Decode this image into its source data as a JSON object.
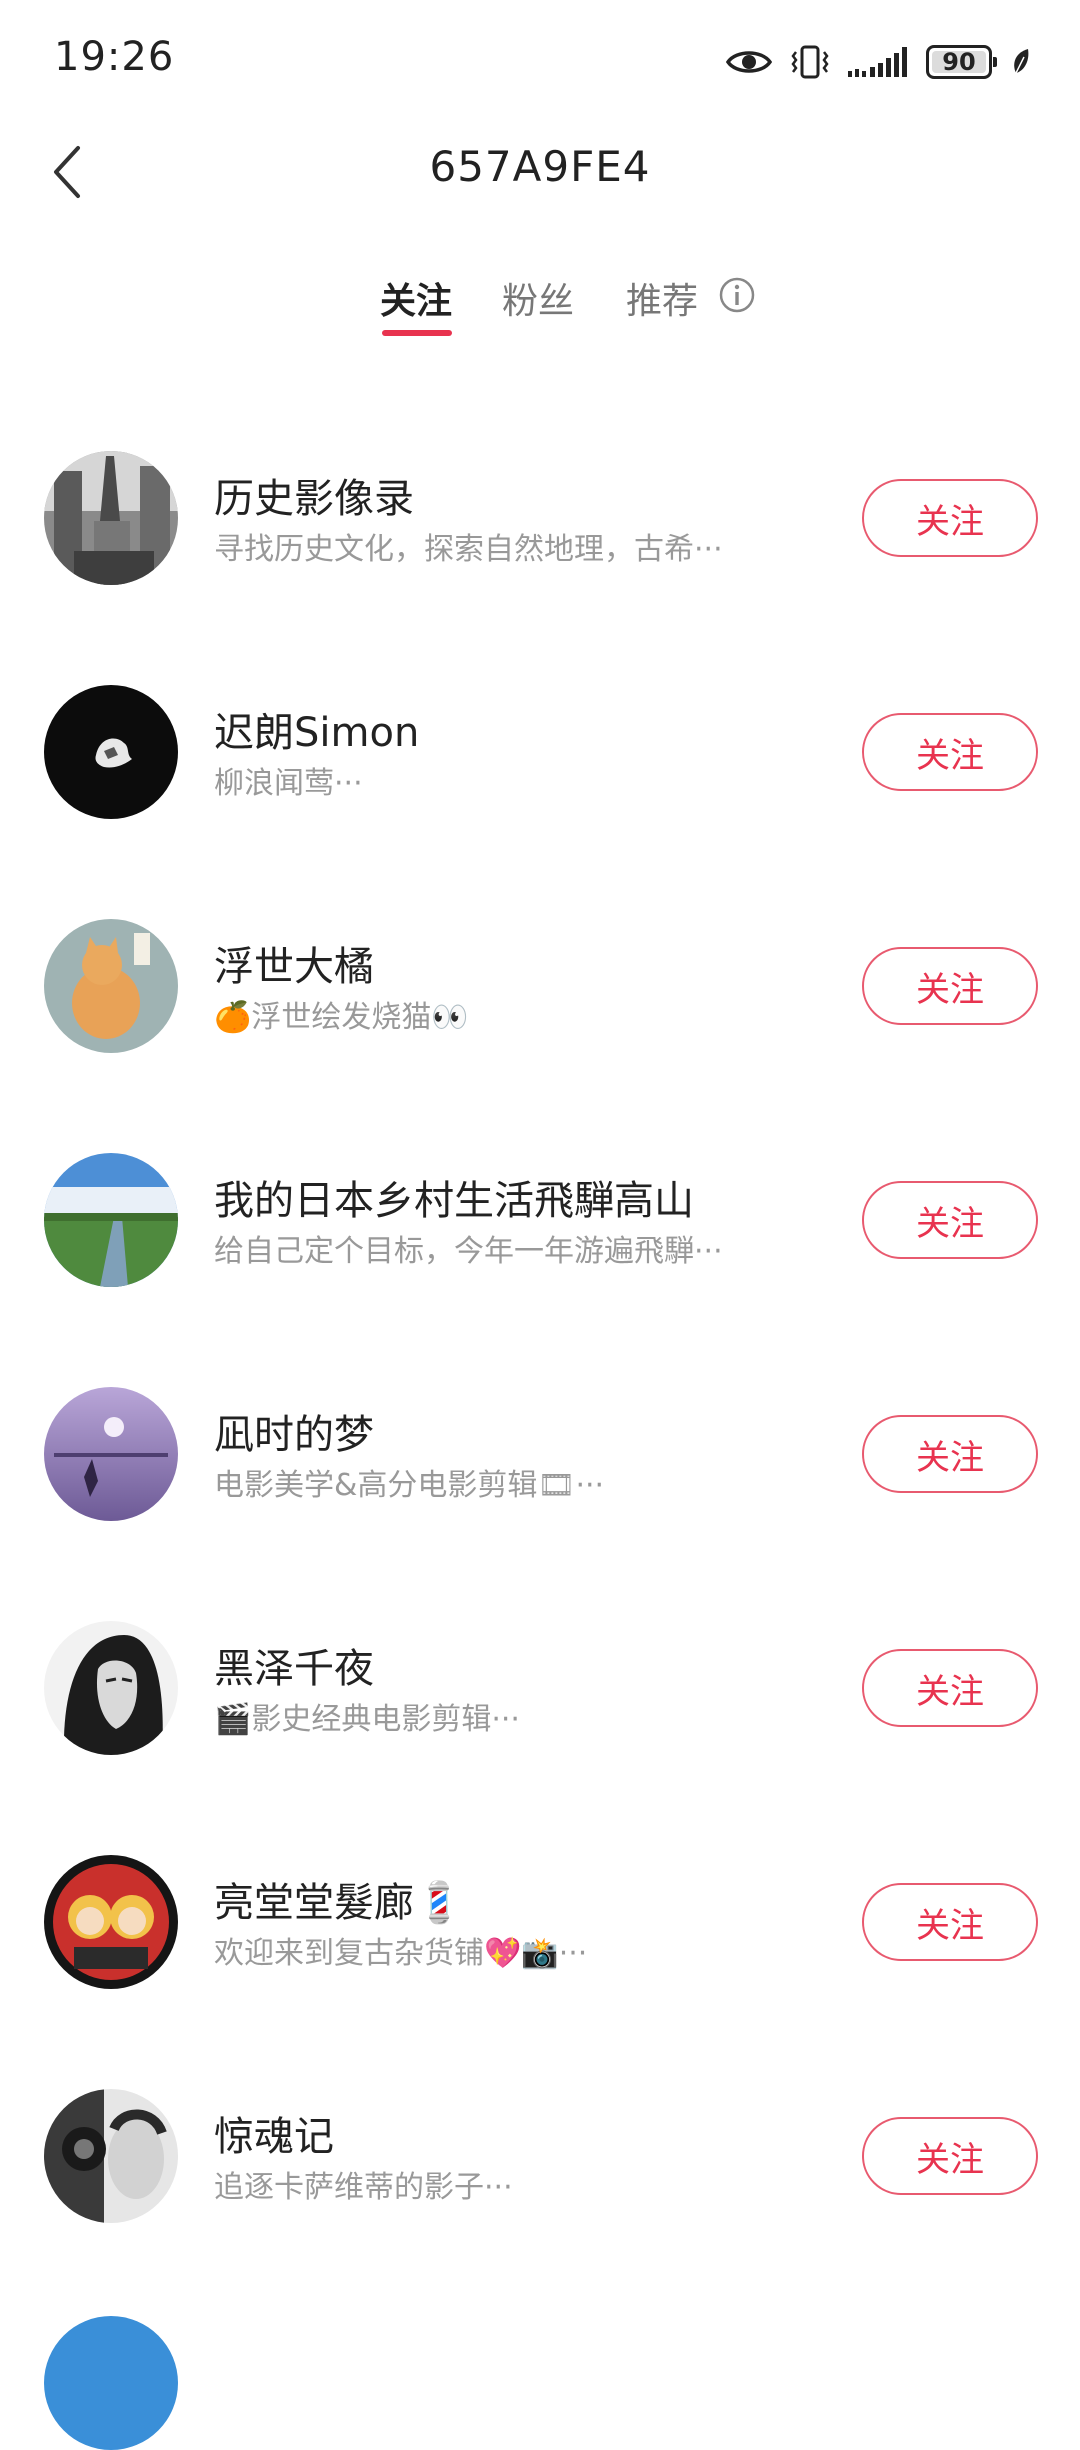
{
  "status_bar": {
    "time": "19:26",
    "battery_level": "90",
    "icons": [
      "eye-icon",
      "vibrate-icon",
      "signal-icon",
      "battery-icon",
      "leaf-icon"
    ]
  },
  "header": {
    "title": "657A9FE4",
    "back_icon": "chevron-left-icon"
  },
  "tabs": [
    {
      "label": "关注",
      "active": true
    },
    {
      "label": "粉丝",
      "active": false
    },
    {
      "label": "推荐",
      "active": false
    }
  ],
  "colors": {
    "accent": "#e8334f",
    "text_primary": "#222222",
    "text_secondary": "#999999"
  },
  "users": [
    {
      "name": "历史影像录",
      "desc": "寻找历史文化，探索自然地理，古希···",
      "follow_label": "关注"
    },
    {
      "name": "迟朗Simon",
      "desc": "柳浪闻莺···",
      "follow_label": "关注"
    },
    {
      "name": "浮世大橘",
      "desc": "🍊浮世绘发烧猫👀",
      "follow_label": "关注"
    },
    {
      "name": "我的日本乡村生活飛騨高山",
      "desc": "给自己定个目标，今年一年游遍飛騨···",
      "follow_label": "关注"
    },
    {
      "name": "凪时的梦",
      "desc": "电影美学&高分电影剪辑🎞···",
      "follow_label": "关注"
    },
    {
      "name": "黑泽千夜",
      "desc": "🎬影史经典电影剪辑···",
      "follow_label": "关注"
    },
    {
      "name": "亮堂堂髮廊💈",
      "desc": "欢迎来到复古杂货铺💖📸···",
      "follow_label": "关注"
    },
    {
      "name": "惊魂记",
      "desc": "追逐卡萨维蒂的影子···",
      "follow_label": "关注"
    }
  ]
}
